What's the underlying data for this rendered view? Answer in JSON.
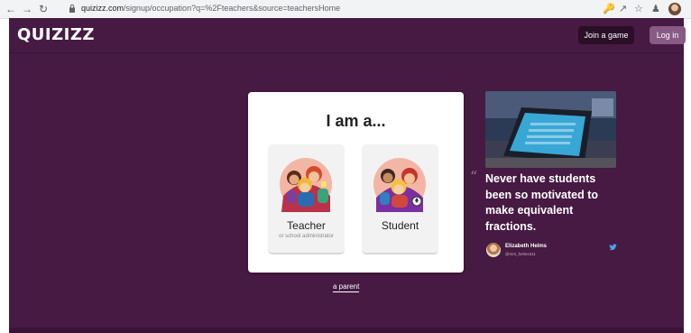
{
  "browser": {
    "url_domain": "quizizz.com",
    "url_path": "/signup/occupation?q=%2Fteachers&source=teachersHome",
    "icons": [
      "back-icon",
      "forward-icon",
      "reload-icon",
      "lock-icon",
      "key-icon",
      "share-icon",
      "star-icon",
      "extensions-icon",
      "profile-icon"
    ]
  },
  "header": {
    "logo": "QUIZIZZ",
    "join_label": "Join a game",
    "login_label": "Log in"
  },
  "card": {
    "title": "I am a...",
    "options": [
      {
        "label": "Teacher",
        "sublabel": "or school administrator"
      },
      {
        "label": "Student",
        "sublabel": ""
      }
    ]
  },
  "parent_link": "a parent",
  "testimonial": {
    "quote": "Never have students been so motivated to make equivalent fractions.",
    "author_name": "Elizabeth Helms",
    "author_handle": "@mrs_helms311"
  },
  "colors": {
    "page_bg": "#461a42",
    "login_button": "#8a5a86",
    "join_button": "#2a0f27",
    "card_bg": "#ffffff"
  }
}
